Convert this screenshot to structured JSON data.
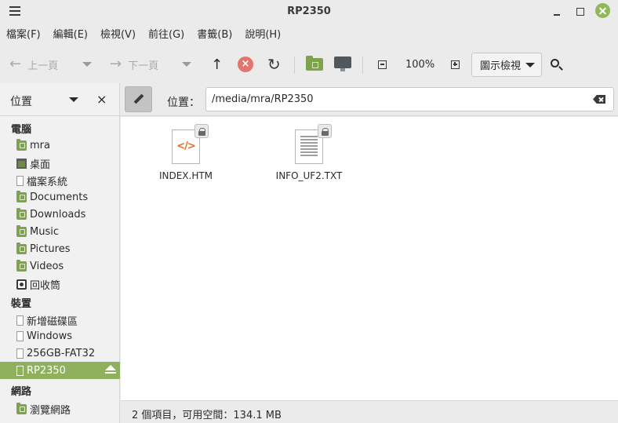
{
  "window": {
    "title": "RP2350"
  },
  "menubar": [
    "檔案(F)",
    "編輯(E)",
    "檢視(V)",
    "前往(G)",
    "書籤(B)",
    "說明(H)"
  ],
  "toolbar": {
    "back_label": "上一頁",
    "forward_label": "下一頁",
    "zoom": "100%",
    "view_label": "圖示檢視"
  },
  "sidebar": {
    "header_label": "位置",
    "sections": {
      "computer": "電腦",
      "devices": "裝置",
      "network": "網路"
    },
    "computer_items": [
      {
        "label": "mra",
        "icon": "home-folder-icon"
      },
      {
        "label": "桌面",
        "icon": "desktop-icon"
      },
      {
        "label": "檔案系統",
        "icon": "drive-icon"
      },
      {
        "label": "Documents",
        "icon": "folder-icon"
      },
      {
        "label": "Downloads",
        "icon": "folder-icon"
      },
      {
        "label": "Music",
        "icon": "folder-icon"
      },
      {
        "label": "Pictures",
        "icon": "folder-icon"
      },
      {
        "label": "Videos",
        "icon": "folder-icon"
      },
      {
        "label": "回收筒",
        "icon": "trash-icon"
      }
    ],
    "device_items": [
      {
        "label": "新增磁碟區",
        "icon": "drive-icon"
      },
      {
        "label": "Windows",
        "icon": "drive-icon"
      },
      {
        "label": "256GB-FAT32",
        "icon": "drive-icon"
      },
      {
        "label": "RP2350",
        "icon": "drive-icon",
        "active": true
      }
    ],
    "network_items": [
      {
        "label": "瀏覽網路",
        "icon": "network-folder-icon"
      }
    ]
  },
  "location": {
    "label": "位置：",
    "path": "/media/mra/RP2350"
  },
  "files": [
    {
      "name": "INDEX.HTM",
      "type": "html-file-icon",
      "locked": true
    },
    {
      "name": "INFO_UF2.TXT",
      "type": "text-file-icon",
      "locked": true
    }
  ],
  "status": {
    "text": "2 個項目，可用空間：134.1 MB"
  },
  "colors": {
    "accent": "#8fb05d",
    "folder": "#7fa24e",
    "close": "#8fb85a",
    "stop": "#e0766f"
  }
}
